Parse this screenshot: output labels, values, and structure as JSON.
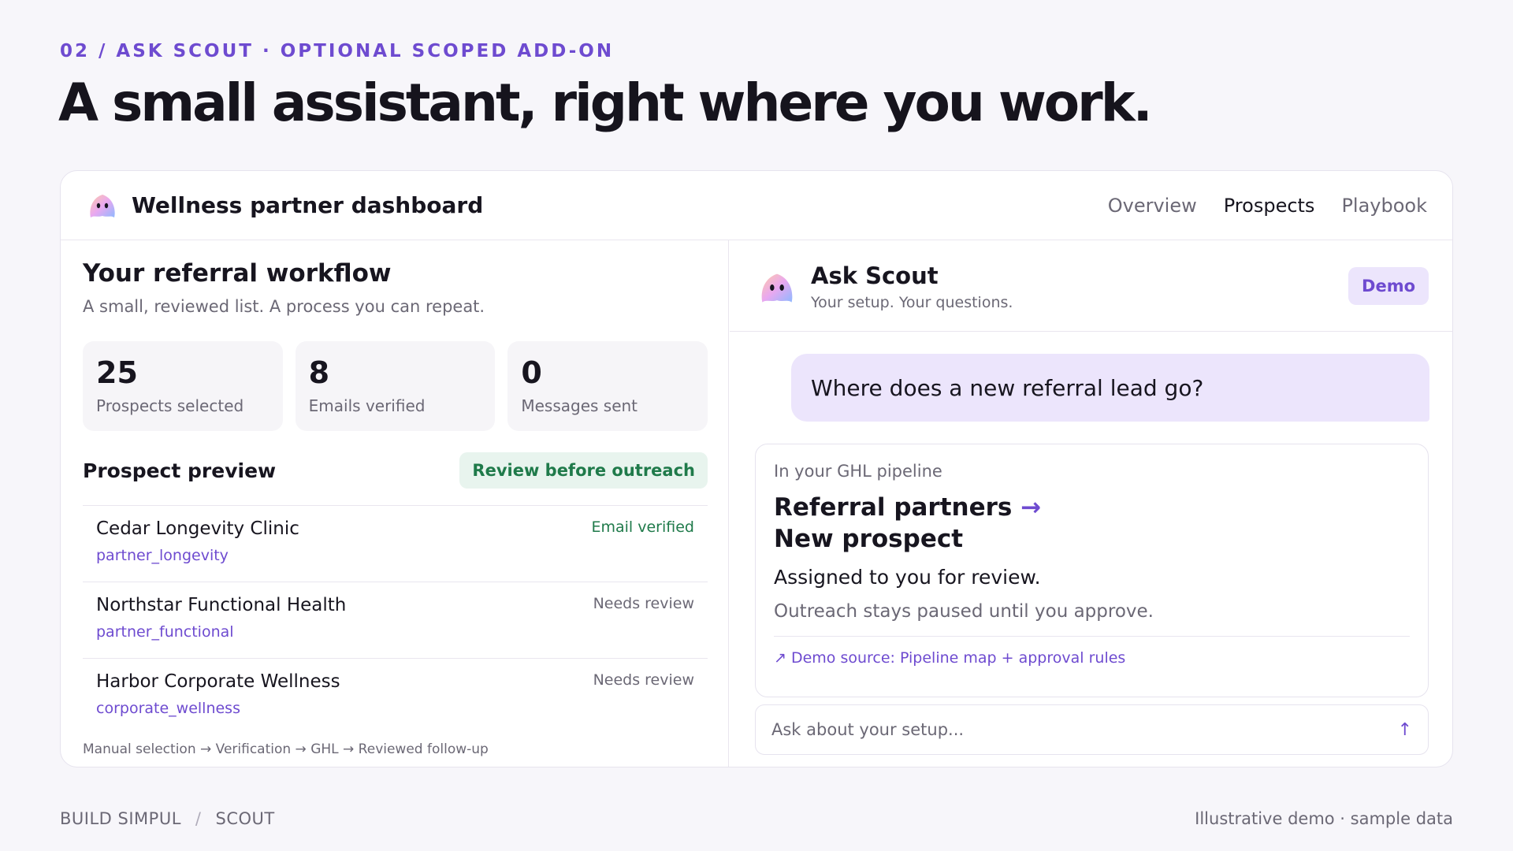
{
  "eyebrow": "02 / ASK SCOUT · OPTIONAL SCOPED ADD-ON",
  "headline": "A small assistant, right where you work.",
  "dashboard": {
    "title": "Wellness partner dashboard",
    "nav": [
      "Overview",
      "Prospects",
      "Playbook"
    ],
    "active_nav": "Prospects"
  },
  "workflow": {
    "title": "Your referral workflow",
    "subtitle": "A small, reviewed list. A process you can repeat.",
    "stats": [
      {
        "value": "25",
        "label": "Prospects selected"
      },
      {
        "value": "8",
        "label": "Emails verified"
      },
      {
        "value": "0",
        "label": "Messages sent"
      }
    ],
    "preview_title": "Prospect preview",
    "review_badge": "Review before outreach",
    "prospects": [
      {
        "name": "Cedar Longevity Clinic",
        "tag": "partner_longevity",
        "status": "Email verified"
      },
      {
        "name": "Northstar Functional Health",
        "tag": "partner_functional",
        "status": "Needs review"
      },
      {
        "name": "Harbor Corporate Wellness",
        "tag": "corporate_wellness",
        "status": "Needs review"
      }
    ],
    "flow": "Manual selection → Verification → GHL → Reviewed follow-up"
  },
  "scout": {
    "name": "Ask Scout",
    "subtitle": "Your setup. Your questions.",
    "badge": "Demo",
    "question": "Where does a new referral lead go?",
    "answer": {
      "context": "In your GHL pipeline",
      "destination_line1": "Referral partners",
      "destination_arrow": "→",
      "destination_line2": "New prospect",
      "assignment": "Assigned to you for review.",
      "note": "Outreach stays paused until you approve.",
      "source": "↗ Demo source: Pipeline map + approval rules"
    },
    "input_placeholder": "Ask about your setup...",
    "send_icon": "↑"
  },
  "footer": {
    "brand": "BUILD SIMPUL",
    "separator": "/",
    "product": "SCOUT",
    "note": "Illustrative demo · sample data"
  },
  "colors": {
    "accent": "#6e4bd0",
    "success": "#1f7a4a",
    "muted": "#6b6875"
  }
}
